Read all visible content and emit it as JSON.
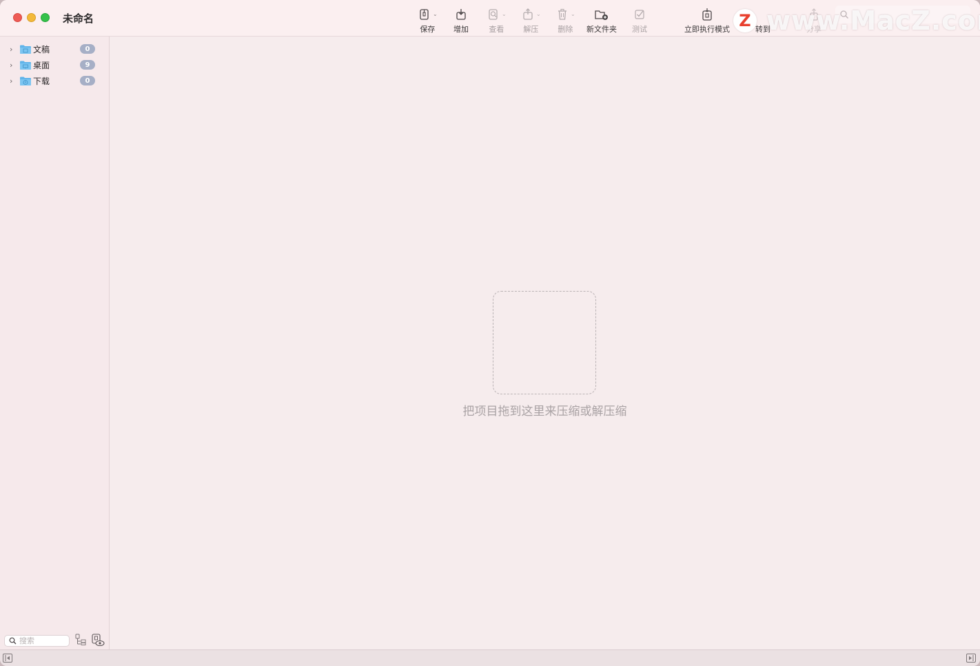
{
  "window": {
    "title": "未命名"
  },
  "toolbar": {
    "items": [
      {
        "label": "保存",
        "icon": "archive-save-icon",
        "has_menu": true,
        "enabled": true
      },
      {
        "label": "增加",
        "icon": "add-to-archive-icon",
        "has_menu": false,
        "enabled": true
      },
      {
        "label": "查看",
        "icon": "view-icon",
        "has_menu": true,
        "enabled": false
      },
      {
        "label": "解压",
        "icon": "extract-icon",
        "has_menu": true,
        "enabled": false
      },
      {
        "label": "删除",
        "icon": "trash-icon",
        "has_menu": true,
        "enabled": false
      },
      {
        "label": "新文件夹",
        "icon": "new-folder-icon",
        "has_menu": false,
        "enabled": true
      },
      {
        "label": "测试",
        "icon": "test-checkmark-icon",
        "has_menu": false,
        "enabled": false
      },
      {
        "label": "立即执行模式",
        "icon": "instant-mode-icon",
        "has_menu": false,
        "enabled": true
      },
      {
        "label": "转到",
        "icon": "goto-icon",
        "has_menu": false,
        "enabled": true
      },
      {
        "label": "分享",
        "icon": "share-icon",
        "has_menu": false,
        "enabled": true
      }
    ]
  },
  "watermark": {
    "logo_letter": "Z",
    "text": "www.MacZ.com"
  },
  "sidebar": {
    "items": [
      {
        "label": "文稿",
        "count": "0",
        "icon": "documents-folder-icon"
      },
      {
        "label": "桌面",
        "count": "9",
        "icon": "desktop-folder-icon"
      },
      {
        "label": "下载",
        "count": "0",
        "icon": "downloads-folder-icon"
      }
    ],
    "search": {
      "placeholder": "搜索"
    }
  },
  "main": {
    "drop_hint": "把项目拖到这里来压缩或解压缩"
  },
  "colors": {
    "close": "#ee5b55",
    "minimize": "#f3b93a",
    "maximize": "#35c14a",
    "badge": "#a6afc6",
    "folder": "#5fb4ea",
    "background": "#f6eced"
  }
}
